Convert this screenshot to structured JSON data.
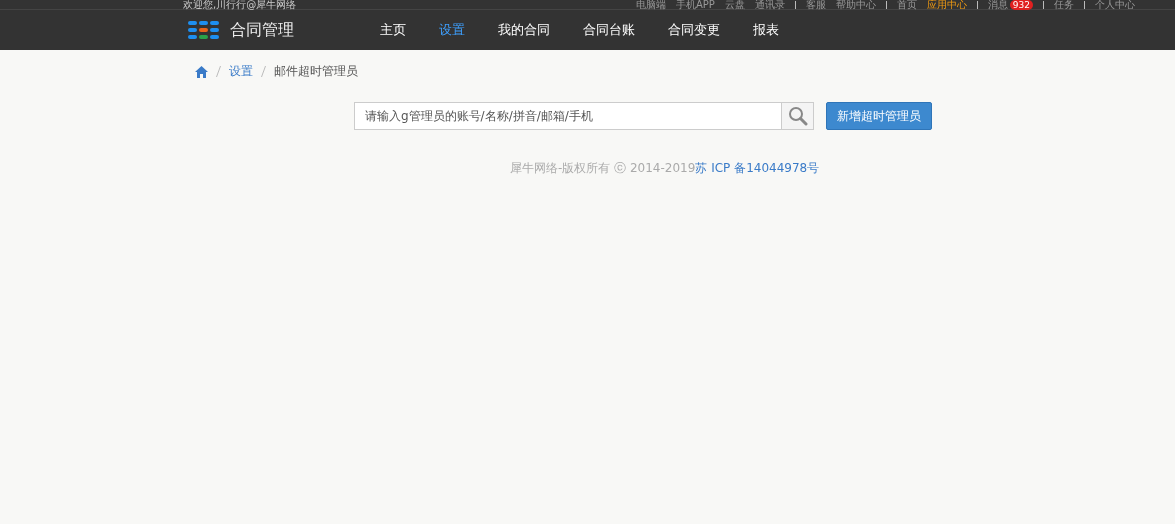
{
  "top_bar": {
    "greeting": "欢迎您,川行行@犀牛网络",
    "links": [
      {
        "label": "电脑端",
        "highlighted": false,
        "separator_after": false
      },
      {
        "label": "手机APP",
        "highlighted": false,
        "separator_after": false
      },
      {
        "label": "云盘",
        "highlighted": false,
        "separator_after": false
      },
      {
        "label": "通讯录",
        "highlighted": false,
        "separator_after": true
      },
      {
        "label": "客服",
        "highlighted": false,
        "separator_after": false
      },
      {
        "label": "帮助中心",
        "highlighted": false,
        "separator_after": true
      },
      {
        "label": "首页",
        "highlighted": false,
        "separator_after": false
      },
      {
        "label": "应用中心",
        "highlighted": true,
        "separator_after": true
      },
      {
        "label": "消息",
        "badge": "932",
        "highlighted": false,
        "separator_after": true
      },
      {
        "label": "任务",
        "highlighted": false,
        "separator_after": true
      },
      {
        "label": "个人中心",
        "highlighted": false,
        "separator_after": false
      }
    ]
  },
  "header": {
    "app_title": "合同管理",
    "nav": [
      {
        "label": "主页",
        "selected": false
      },
      {
        "label": "设置",
        "selected": true
      },
      {
        "label": "我的合同",
        "selected": false
      },
      {
        "label": "合同台账",
        "selected": false
      },
      {
        "label": "合同变更",
        "selected": false
      },
      {
        "label": "报表",
        "selected": false
      }
    ]
  },
  "breadcrumb": [
    "设置",
    "邮件超时管理员"
  ],
  "search": {
    "placeholder": "请输入g管理员的账号/名称/拼音/邮箱/手机"
  },
  "add_button": "新增超时管理员",
  "footer": {
    "copyright": "犀牛网络-版权所有 ⓒ 2014-2019",
    "icp_link": "苏 ICP 备14044978号"
  }
}
